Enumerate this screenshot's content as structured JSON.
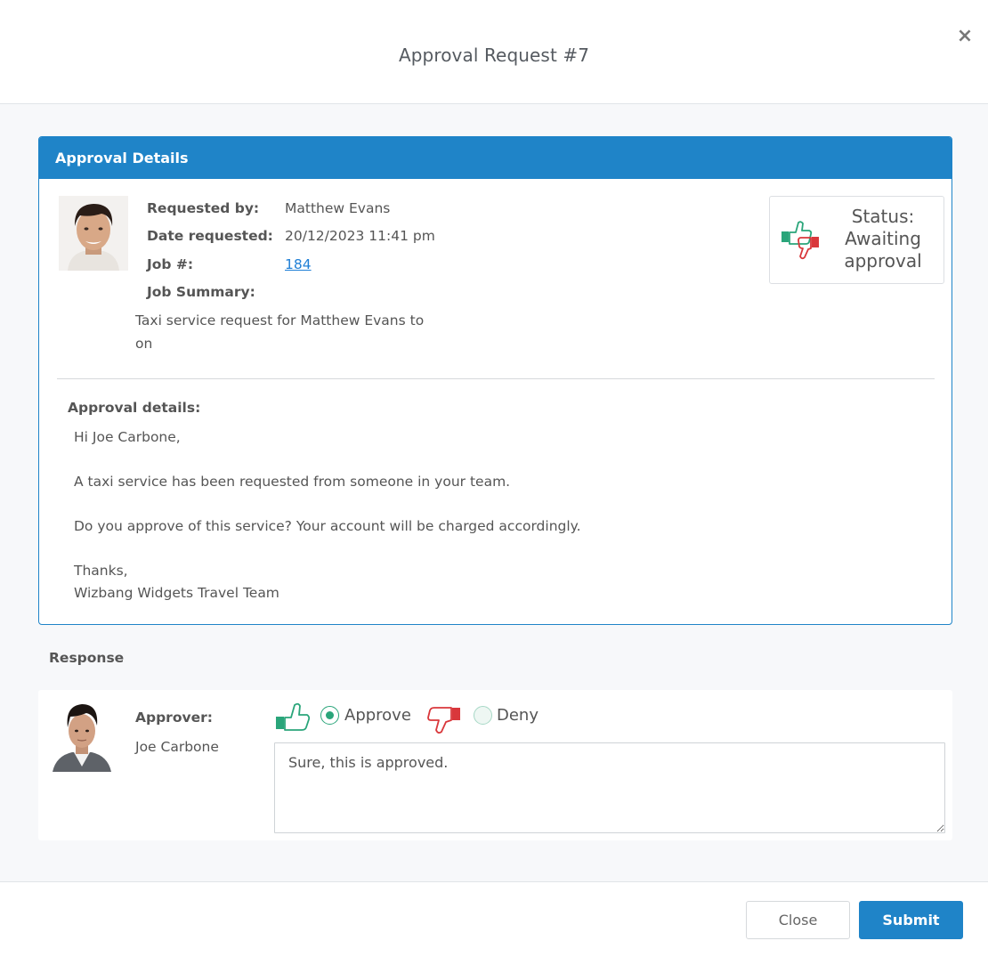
{
  "modal": {
    "title": "Approval Request #7",
    "close_icon": "×"
  },
  "panel": {
    "heading": "Approval Details",
    "requested_by_label": "Requested by:",
    "requested_by_value": "Matthew Evans",
    "date_requested_label": "Date requested:",
    "date_requested_value": "20/12/2023 11:41 pm",
    "job_label": "Job #:",
    "job_value": "184",
    "job_summary_label": "Job Summary:",
    "job_summary_value": "Taxi service request for Matthew Evans to on",
    "status": {
      "line1": "Status:",
      "line2": "Awaiting",
      "line3": "approval",
      "icon": "thumbs-up-down-icon"
    },
    "details_label": "Approval details:",
    "message": [
      "Hi Joe Carbone,",
      "A taxi service has been requested from someone in your team.",
      "Do you approve of this service? Your account will be charged accordingly.",
      "Thanks,",
      "Wizbang Widgets Travel Team"
    ]
  },
  "response": {
    "heading": "Response",
    "approver_label": "Approver:",
    "approver_name": "Joe Carbone",
    "approve_label": "Approve",
    "deny_label": "Deny",
    "selected": "Approve",
    "comment": "Sure, this is approved."
  },
  "footer": {
    "close_label": "Close",
    "submit_label": "Submit"
  },
  "colors": {
    "primary": "#1f84c8",
    "approve_green": "#2aa57a",
    "deny_red": "#d9373b",
    "link": "#1f7fd6"
  }
}
